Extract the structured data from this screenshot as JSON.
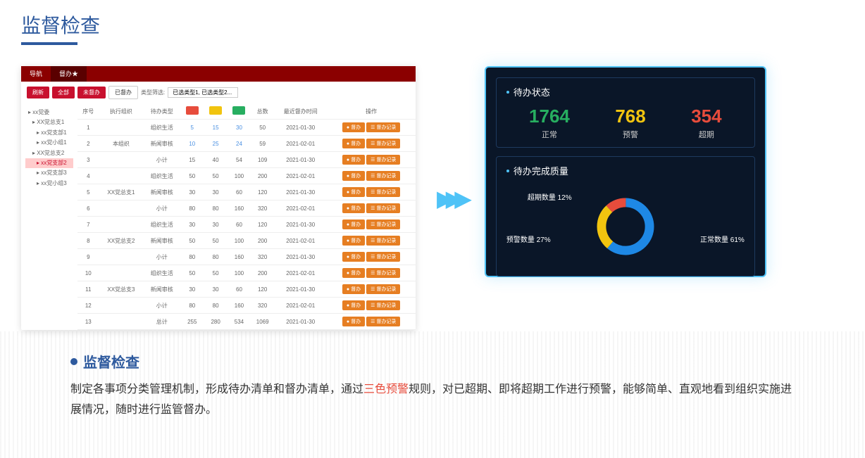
{
  "page": {
    "title": "监督检查"
  },
  "leftPanel": {
    "tabs": [
      "导航",
      "督办★"
    ],
    "toolbar": {
      "refresh": "刷新",
      "all": "全部",
      "pending": "未督办",
      "done": "已督办",
      "filterLabel": "类型筛选:",
      "filterValue": "已选类型1, 已选类型2..."
    },
    "tree": [
      {
        "label": "xx党委",
        "level": 1
      },
      {
        "label": "XX党总支1",
        "level": 2
      },
      {
        "label": "xx党支部1",
        "level": 3
      },
      {
        "label": "xx党小组1",
        "level": 3
      },
      {
        "label": "XX党总支2",
        "level": 2
      },
      {
        "label": "xx党支部2",
        "level": 3,
        "selected": true
      },
      {
        "label": "xx党支部3",
        "level": 3
      },
      {
        "label": "xx党小组3",
        "level": 3
      }
    ],
    "headers": [
      "序号",
      "执行组织",
      "待办类型",
      "",
      "",
      "",
      "总数",
      "最近督办时间",
      "操作"
    ],
    "actions": {
      "supervise": "● 督办",
      "record": "☰ 督办记录"
    },
    "rows": [
      {
        "idx": "1",
        "org": "",
        "type": "组织生活",
        "r": "5",
        "y": "15",
        "g": "30",
        "total": "50",
        "time": "2021-01-30",
        "link": true
      },
      {
        "idx": "2",
        "org": "本组织",
        "type": "新闻审核",
        "r": "10",
        "y": "25",
        "g": "24",
        "total": "59",
        "time": "2021-02-01",
        "link": true
      },
      {
        "idx": "3",
        "org": "",
        "type": "小计",
        "r": "15",
        "y": "40",
        "g": "54",
        "total": "109",
        "time": "2021-01-30"
      },
      {
        "idx": "4",
        "org": "",
        "type": "组织生活",
        "r": "50",
        "y": "50",
        "g": "100",
        "total": "200",
        "time": "2021-02-01"
      },
      {
        "idx": "5",
        "org": "XX党总支1",
        "type": "新闻审核",
        "r": "30",
        "y": "30",
        "g": "60",
        "total": "120",
        "time": "2021-01-30"
      },
      {
        "idx": "6",
        "org": "",
        "type": "小计",
        "r": "80",
        "y": "80",
        "g": "160",
        "total": "320",
        "time": "2021-02-01"
      },
      {
        "idx": "7",
        "org": "",
        "type": "组织生活",
        "r": "30",
        "y": "30",
        "g": "60",
        "total": "120",
        "time": "2021-01-30"
      },
      {
        "idx": "8",
        "org": "XX党总支2",
        "type": "新闻审核",
        "r": "50",
        "y": "50",
        "g": "100",
        "total": "200",
        "time": "2021-02-01"
      },
      {
        "idx": "9",
        "org": "",
        "type": "小计",
        "r": "80",
        "y": "80",
        "g": "160",
        "total": "320",
        "time": "2021-01-30"
      },
      {
        "idx": "10",
        "org": "",
        "type": "组织生活",
        "r": "50",
        "y": "50",
        "g": "100",
        "total": "200",
        "time": "2021-02-01"
      },
      {
        "idx": "11",
        "org": "XX党总支3",
        "type": "新闻审核",
        "r": "30",
        "y": "30",
        "g": "60",
        "total": "120",
        "time": "2021-01-30"
      },
      {
        "idx": "12",
        "org": "",
        "type": "小计",
        "r": "80",
        "y": "80",
        "g": "160",
        "total": "320",
        "time": "2021-02-01"
      },
      {
        "idx": "13",
        "org": "",
        "type": "总计",
        "r": "255",
        "y": "280",
        "g": "534",
        "total": "1069",
        "time": "2021-01-30"
      }
    ]
  },
  "rightPanel": {
    "status": {
      "title": "待办状态",
      "items": [
        {
          "num": "1764",
          "label": "正常",
          "color": "c-green"
        },
        {
          "num": "768",
          "label": "预警",
          "color": "c-yellow"
        },
        {
          "num": "354",
          "label": "超期",
          "color": "c-red"
        }
      ]
    },
    "quality": {
      "title": "待办完成质量",
      "labels": {
        "overdue": "超期数量 12%",
        "warning": "预警数量 27%",
        "normal": "正常数量 61%"
      }
    }
  },
  "chart_data": {
    "type": "pie",
    "title": "待办完成质量",
    "series": [
      {
        "name": "正常数量",
        "value": 61
      },
      {
        "name": "预警数量",
        "value": 27
      },
      {
        "name": "超期数量",
        "value": 12
      }
    ]
  },
  "description": {
    "title": "监督检查",
    "textBefore": "制定各事项分类管理机制，形成待办清单和督办清单，通过",
    "highlight": "三色预警",
    "textAfter": "规则，对已超期、即将超期工作进行预警，能够简单、直观地看到组织实施进展情况，随时进行监管督办。"
  }
}
